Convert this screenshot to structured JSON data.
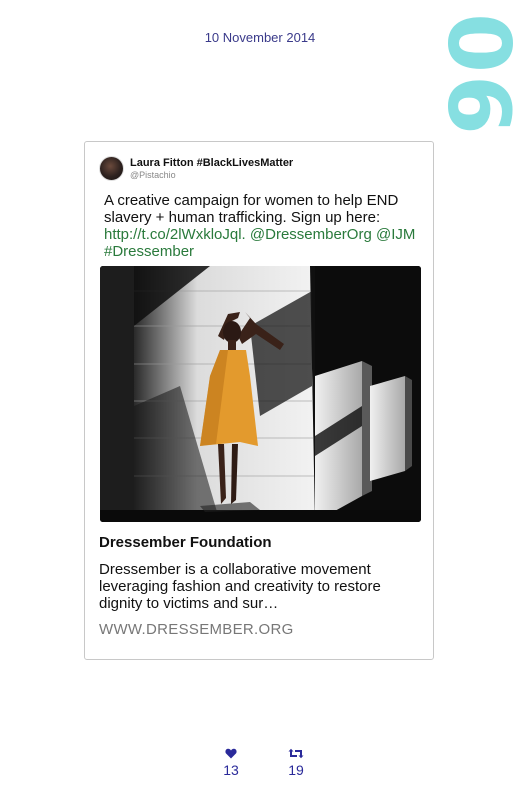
{
  "date": "10 November 2014",
  "tweet_number": "06",
  "tweet": {
    "author_name": "Laura Fitton #BlackLivesMatter",
    "author_handle": "@Pistachio",
    "text_part1": "A creative campaign for women to help END slavery + human trafficking. Sign up here: ",
    "link": "http://t.co/2lWxkloJql.",
    "mentions": "@DressemberOrg @IJM #Dressember"
  },
  "link_card": {
    "title": "Dressember Foundation",
    "description": "Dressember is a collaborative movement leveraging fashion and creativity to restore dignity to victims and sur…",
    "domain": "WWW.DRESSEMBER.ORG"
  },
  "stats": {
    "likes": "13",
    "retweets": "19"
  },
  "icons": {
    "likes": "heart-icon",
    "retweets": "retweet-icon"
  },
  "colors": {
    "accent_number": "#86dfe1",
    "link_green": "#2a7a3c",
    "stat_blue": "#2a2a9a",
    "dress_orange": "#e39a2d"
  }
}
